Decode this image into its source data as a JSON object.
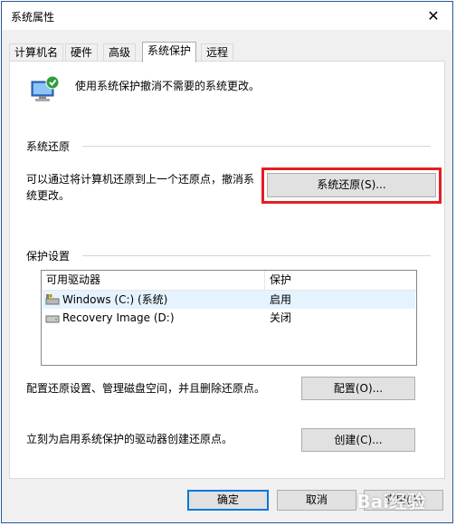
{
  "window": {
    "title": "系统属性",
    "close_glyph": "✕"
  },
  "tabs": [
    {
      "label": "计算机名",
      "active": false
    },
    {
      "label": "硬件",
      "active": false
    },
    {
      "label": "高级",
      "active": false
    },
    {
      "label": "系统保护",
      "active": true
    },
    {
      "label": "远程",
      "active": false
    }
  ],
  "intro": {
    "text": "使用系统保护撤消不需要的系统更改。",
    "icon": "system-protection-icon"
  },
  "restore": {
    "group_label": "系统还原",
    "description": "可以通过将计算机还原到上一个还原点，撤消系统更改。",
    "button_label": "系统还原(S)..."
  },
  "protection": {
    "group_label": "保护设置",
    "columns": [
      "可用驱动器",
      "保护"
    ],
    "drives": [
      {
        "name": "Windows (C:) (系统)",
        "protection": "启用",
        "icon": "system-drive-icon"
      },
      {
        "name": "Recovery Image (D:)",
        "protection": "关闭",
        "icon": "drive-icon"
      }
    ],
    "configure_desc": "配置还原设置、管理磁盘空间，并且删除还原点。",
    "configure_label": "配置(O)...",
    "create_desc": "立刻为启用系统保护的驱动器创建还原点。",
    "create_label": "创建(C)..."
  },
  "footer": {
    "ok_label": "确定",
    "cancel_label": "取消",
    "apply_label": "应用(A)"
  },
  "watermark": "Bai经验",
  "colors": {
    "highlight": "#e31e24",
    "accent": "#0078d7"
  }
}
